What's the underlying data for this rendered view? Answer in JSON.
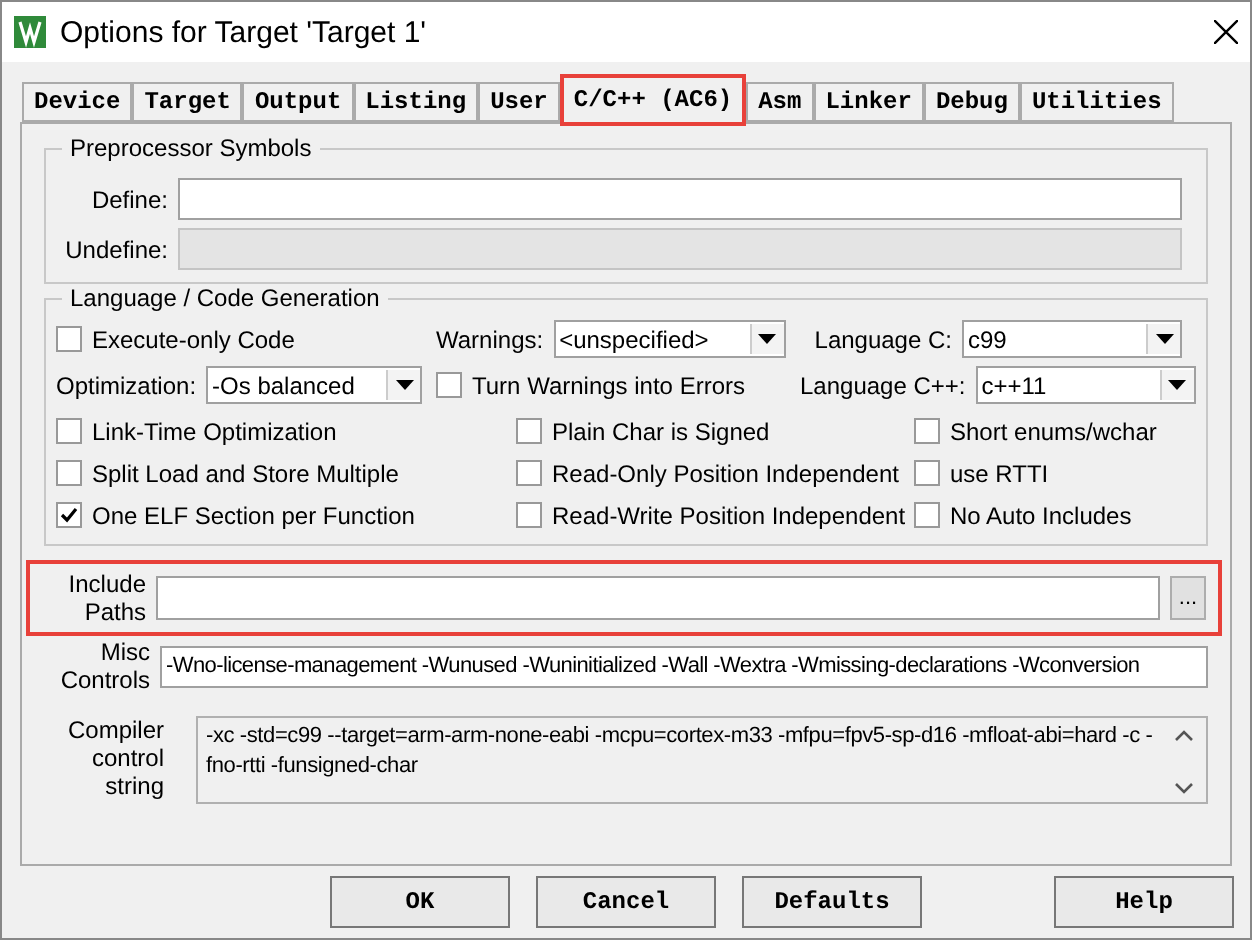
{
  "window": {
    "title": "Options for Target 'Target 1'"
  },
  "tabs": [
    {
      "label": "Device",
      "selected": false,
      "highlighted": false
    },
    {
      "label": "Target",
      "selected": false,
      "highlighted": false
    },
    {
      "label": "Output",
      "selected": false,
      "highlighted": false
    },
    {
      "label": "Listing",
      "selected": false,
      "highlighted": false
    },
    {
      "label": "User",
      "selected": false,
      "highlighted": false
    },
    {
      "label": "C/C++ (AC6)",
      "selected": true,
      "highlighted": true
    },
    {
      "label": "Asm",
      "selected": false,
      "highlighted": false
    },
    {
      "label": "Linker",
      "selected": false,
      "highlighted": false
    },
    {
      "label": "Debug",
      "selected": false,
      "highlighted": false
    },
    {
      "label": "Utilities",
      "selected": false,
      "highlighted": false
    }
  ],
  "preprocessor": {
    "title": "Preprocessor Symbols",
    "fields": [
      {
        "label": "Define:",
        "disabled": false
      },
      {
        "label": "Undefine:",
        "disabled": true
      }
    ]
  },
  "language": {
    "title": "Language / Code Generation",
    "rows": [
      [
        {
          "kind": "checkbox",
          "label": "Execute-only Code",
          "checked": false
        },
        {
          "kind": "select",
          "label": "Warnings:",
          "value": "<unspecified>"
        },
        {
          "kind": "select",
          "label": "Language C:",
          "value": "c99"
        }
      ],
      [
        {
          "kind": "select",
          "label": "Optimization:",
          "value": "-Os balanced"
        },
        {
          "kind": "checkbox",
          "label": "Turn Warnings into Errors",
          "checked": false
        },
        {
          "kind": "select",
          "label": "Language C++:",
          "value": "c++11"
        }
      ],
      [
        {
          "kind": "checkbox",
          "label": "Link-Time Optimization",
          "checked": false
        },
        {
          "kind": "checkbox",
          "label": "Plain Char is Signed",
          "checked": false
        },
        {
          "kind": "checkbox",
          "label": "Short enums/wchar",
          "checked": false
        }
      ],
      [
        {
          "kind": "checkbox",
          "label": "Split Load and Store Multiple",
          "checked": false
        },
        {
          "kind": "checkbox",
          "label": "Read-Only Position Independent",
          "checked": false
        },
        {
          "kind": "checkbox",
          "label": "use RTTI",
          "checked": false
        }
      ],
      [
        {
          "kind": "checkbox",
          "label": "One ELF Section per Function",
          "checked": true
        },
        {
          "kind": "checkbox",
          "label": "Read-Write Position Independent",
          "checked": false
        },
        {
          "kind": "checkbox",
          "label": "No Auto Includes",
          "checked": false
        }
      ]
    ]
  },
  "include_paths": {
    "label": "Include Paths",
    "highlighted": true,
    "button": "..."
  },
  "misc_controls": {
    "label": "Misc Controls",
    "value": "-Wno-license-management -Wunused -Wuninitialized -Wall -Wextra -Wmissing-declarations -Wconversion"
  },
  "compiler_string": {
    "label": "Compiler control string",
    "value": "-xc -std=c99 --target=arm-arm-none-eabi -mcpu=cortex-m33 -mfpu=fpv5-sp-d16 -mfloat-abi=hard -c -fno-rtti -funsigned-char"
  },
  "buttons": [
    "OK",
    "Cancel",
    "Defaults"
  ],
  "help_button": "Help"
}
